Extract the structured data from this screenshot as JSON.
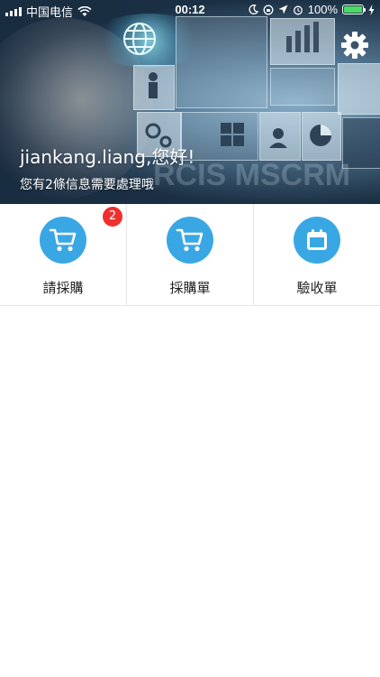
{
  "status_bar": {
    "carrier": "中国电信",
    "time": "00:12",
    "battery_percent": "100%"
  },
  "header": {
    "greeting": "jiankang.liang,您好!",
    "message": "您有2條信息需要處理哦"
  },
  "menu": [
    {
      "label": "請採購",
      "icon": "cart-icon",
      "badge": "2"
    },
    {
      "label": "採購單",
      "icon": "cart-icon",
      "badge": ""
    },
    {
      "label": "驗收單",
      "icon": "calendar-icon",
      "badge": ""
    }
  ],
  "colors": {
    "accent": "#3aa7e5",
    "badge": "#f0302e",
    "battery": "#4cd964"
  }
}
